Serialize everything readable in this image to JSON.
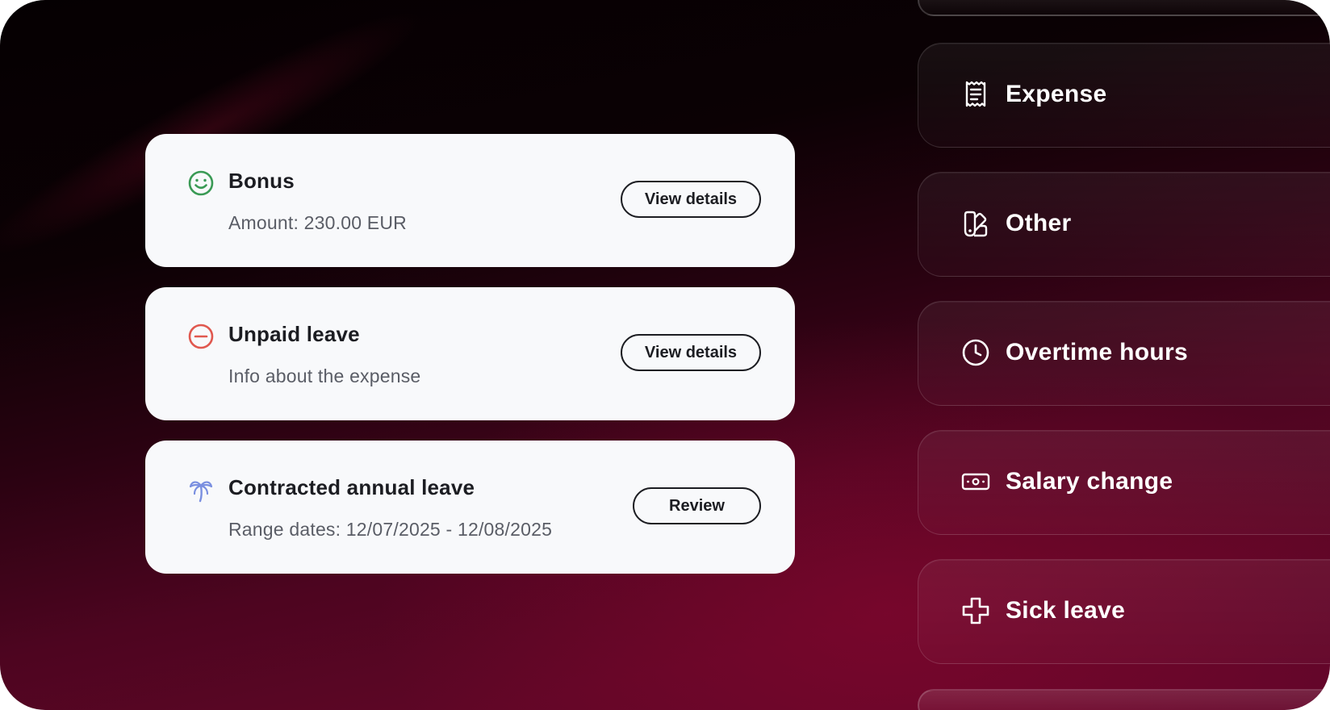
{
  "cards": [
    {
      "title": "Bonus",
      "subtitle": "Amount: 230.00 EUR",
      "button_label": "View details",
      "icon": "smile-icon",
      "icon_color": "#3a9a55"
    },
    {
      "title": "Unpaid leave",
      "subtitle": "Info about the expense",
      "button_label": "View details",
      "icon": "minus-circle-icon",
      "icon_color": "#e0584f"
    },
    {
      "title": "Contracted annual leave",
      "subtitle": "Range dates: 12/07/2025 - 12/08/2025",
      "button_label": "Review",
      "icon": "palm-tree-icon",
      "icon_color": "#7a8fe0"
    }
  ],
  "menu": {
    "items": [
      {
        "label": "Expense",
        "icon": "receipt-icon"
      },
      {
        "label": "Other",
        "icon": "swatches-icon"
      },
      {
        "label": "Overtime hours",
        "icon": "clock-icon"
      },
      {
        "label": "Salary change",
        "icon": "banknote-icon"
      },
      {
        "label": "Sick leave",
        "icon": "medical-cross-icon"
      }
    ]
  },
  "colors": {
    "card_background": "#f8f9fb",
    "text_primary": "#1c1d22",
    "text_secondary": "#5a5d66",
    "background_top": "#050002",
    "background_bottom": "#62062a"
  }
}
